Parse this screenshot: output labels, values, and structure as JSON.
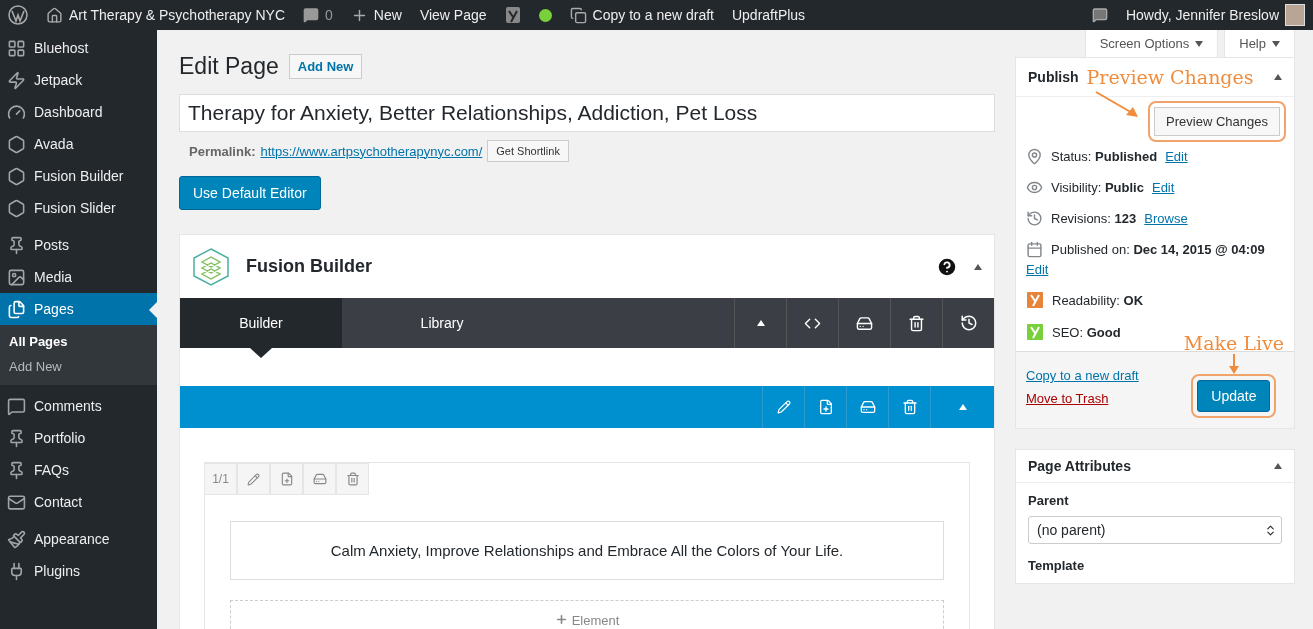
{
  "admin_bar": {
    "site_title": "Art Therapy & Psychotherapy NYC",
    "comments_count": "0",
    "new_label": "New",
    "view_page": "View Page",
    "copy_draft": "Copy to a new draft",
    "updraft": "UpdraftPlus",
    "greeting": "Howdy, Jennifer Breslow"
  },
  "screen_tabs": [
    {
      "label": "Screen Options"
    },
    {
      "label": "Help"
    }
  ],
  "sidebar": {
    "sections": [
      {
        "items": [
          {
            "label": "Bluehost",
            "selected": false
          },
          {
            "label": "Jetpack",
            "selected": false
          },
          {
            "label": "Dashboard",
            "selected": false
          },
          {
            "label": "Avada",
            "selected": false
          },
          {
            "label": "Fusion Builder",
            "selected": false
          },
          {
            "label": "Fusion Slider",
            "selected": false
          }
        ]
      },
      {
        "items": [
          {
            "label": "Posts",
            "selected": false
          },
          {
            "label": "Media",
            "selected": false
          },
          {
            "label": "Pages",
            "selected": true,
            "children": [
              {
                "label": "All Pages",
                "selected": true
              },
              {
                "label": "Add New",
                "selected": false
              }
            ]
          }
        ]
      },
      {
        "items": [
          {
            "label": "Comments",
            "selected": false
          },
          {
            "label": "Portfolio",
            "selected": false
          },
          {
            "label": "FAQs",
            "selected": false
          },
          {
            "label": "Contact",
            "selected": false
          }
        ]
      },
      {
        "items": [
          {
            "label": "Appearance",
            "selected": false
          },
          {
            "label": "Plugins",
            "selected": false
          }
        ]
      }
    ]
  },
  "editor": {
    "heading": "Edit Page",
    "add_new": "Add New",
    "title_value": "Therapy for Anxiety, Better Relationships, Addiction, Pet Loss",
    "permalink_label": "Permalink:",
    "permalink_url": "https://www.artpsychotherapynyc.com/",
    "shortlink_button": "Get Shortlink",
    "default_editor_button": "Use Default Editor"
  },
  "fusion_builder": {
    "title": "Fusion Builder",
    "tabs": [
      {
        "label": "Builder",
        "selected": true
      },
      {
        "label": "Library",
        "selected": false
      }
    ],
    "column_size": "1/1",
    "text_block": "Calm Anxiety, Improve Relationships and Embrace All the Colors of Your Life.",
    "add_element": "Element"
  },
  "publish": {
    "title": "Publish",
    "preview_annotation": "Preview Changes",
    "preview_button": "Preview Changes",
    "rows": [
      {
        "text": "Status: **Published**",
        "link": "Edit"
      },
      {
        "text": "Visibility: **Public**",
        "link": "Edit"
      },
      {
        "text": "Revisions: **123**",
        "link": "Browse"
      },
      {
        "text": "Published on: **Dec 14, 2015 @ 04:09**",
        "link": "Edit"
      },
      {
        "text": "Readability: **OK**",
        "color": "#e8833a"
      },
      {
        "text": "SEO: **Good**",
        "color": "#7ad03a"
      }
    ],
    "copy_link": "Copy to a new draft",
    "trash_link": "Move to Trash",
    "update_annotation": "Make Live",
    "update_button": "Update"
  },
  "page_attributes": {
    "title": "Page Attributes",
    "parent_label": "Parent",
    "parent_value": "(no parent)",
    "template_label": "Template"
  }
}
